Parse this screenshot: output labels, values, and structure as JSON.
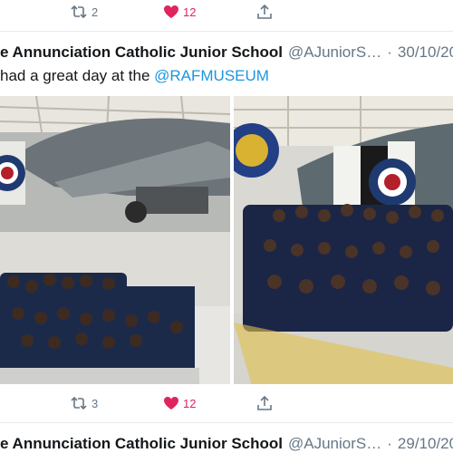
{
  "top_actions": {
    "retweet_icon": "retweet-icon",
    "retweet_count": "2",
    "like_icon": "heart-icon",
    "like_count": "12",
    "share_icon": "share-icon"
  },
  "tweet": {
    "author_name": "e Annunciation Catholic Junior School",
    "handle": "@AJuniorS…",
    "separator": "·",
    "date": "30/10/20",
    "text_prefix": "had a great day at the ",
    "mention": "@RAFMUSEUM",
    "photos": [
      {
        "description_icon": "photo-aircraft-group-left"
      },
      {
        "description_icon": "photo-aircraft-group-right"
      }
    ],
    "actions": {
      "retweet_count": "3",
      "like_count": "12"
    }
  },
  "next_tweet": {
    "author_name": "e Annunciation Catholic Junior School",
    "handle": "@AJuniorS…",
    "separator": "·",
    "date": "29/10/20"
  },
  "colors": {
    "like": "#e0245e",
    "link": "#1b95e0",
    "muted": "#657786"
  }
}
